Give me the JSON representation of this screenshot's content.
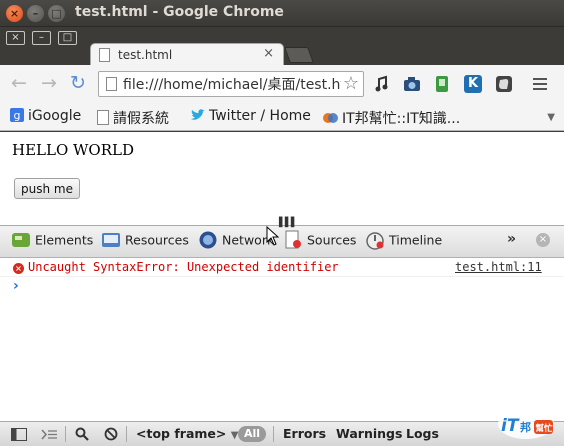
{
  "window": {
    "title": "test.html - Google Chrome",
    "close": "×",
    "minimize": "–",
    "maximize": "□"
  },
  "tab": {
    "title": "test.html",
    "close": "×"
  },
  "toolbar": {
    "back": "←",
    "forward": "→",
    "reload": "↻",
    "url": "file:///home/michael/桌面/test.html",
    "star": "☆",
    "ext_k": "K"
  },
  "bookmarks": [
    {
      "label": "iGoogle"
    },
    {
      "label": "請假系統"
    },
    {
      "label": "Twitter / Home"
    },
    {
      "label": "IT邦幫忙::IT知識..."
    }
  ],
  "page": {
    "heading": "HELLO WORLD",
    "button": "push me"
  },
  "devtools": {
    "tabs": [
      "Elements",
      "Resources",
      "Network",
      "Sources",
      "Timeline"
    ],
    "more": "»",
    "close": "×",
    "console": {
      "error_text": "Uncaught SyntaxError: Unexpected identifier",
      "error_source": "test.html:11",
      "prompt": "›"
    },
    "status": {
      "frame": "<top frame>",
      "frame_arrow": "▼",
      "all": "All",
      "filters": [
        "Errors",
        "Warnings",
        "Logs"
      ]
    }
  },
  "watermark": {
    "text": "iT邦幫忙"
  }
}
